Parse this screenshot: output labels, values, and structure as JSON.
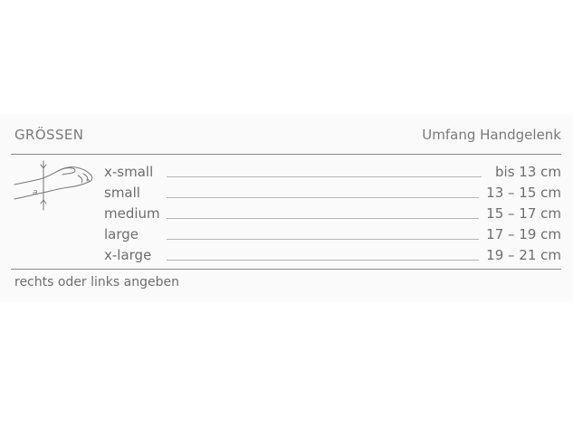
{
  "header": {
    "title": "GRÖSSEN",
    "column_label": "Umfang Handgelenk"
  },
  "illustration": {
    "icon": "wrist-measurement-icon",
    "marker_letter": "a"
  },
  "sizes": [
    {
      "label": "x-small",
      "range": "bis 13 cm"
    },
    {
      "label": "small",
      "range": "13 – 15 cm"
    },
    {
      "label": "medium",
      "range": "15 – 17 cm"
    },
    {
      "label": "large",
      "range": "17 – 19 cm"
    },
    {
      "label": "x-large",
      "range": "19 – 21 cm"
    }
  ],
  "footer": {
    "note": "rechts oder links angeben"
  }
}
